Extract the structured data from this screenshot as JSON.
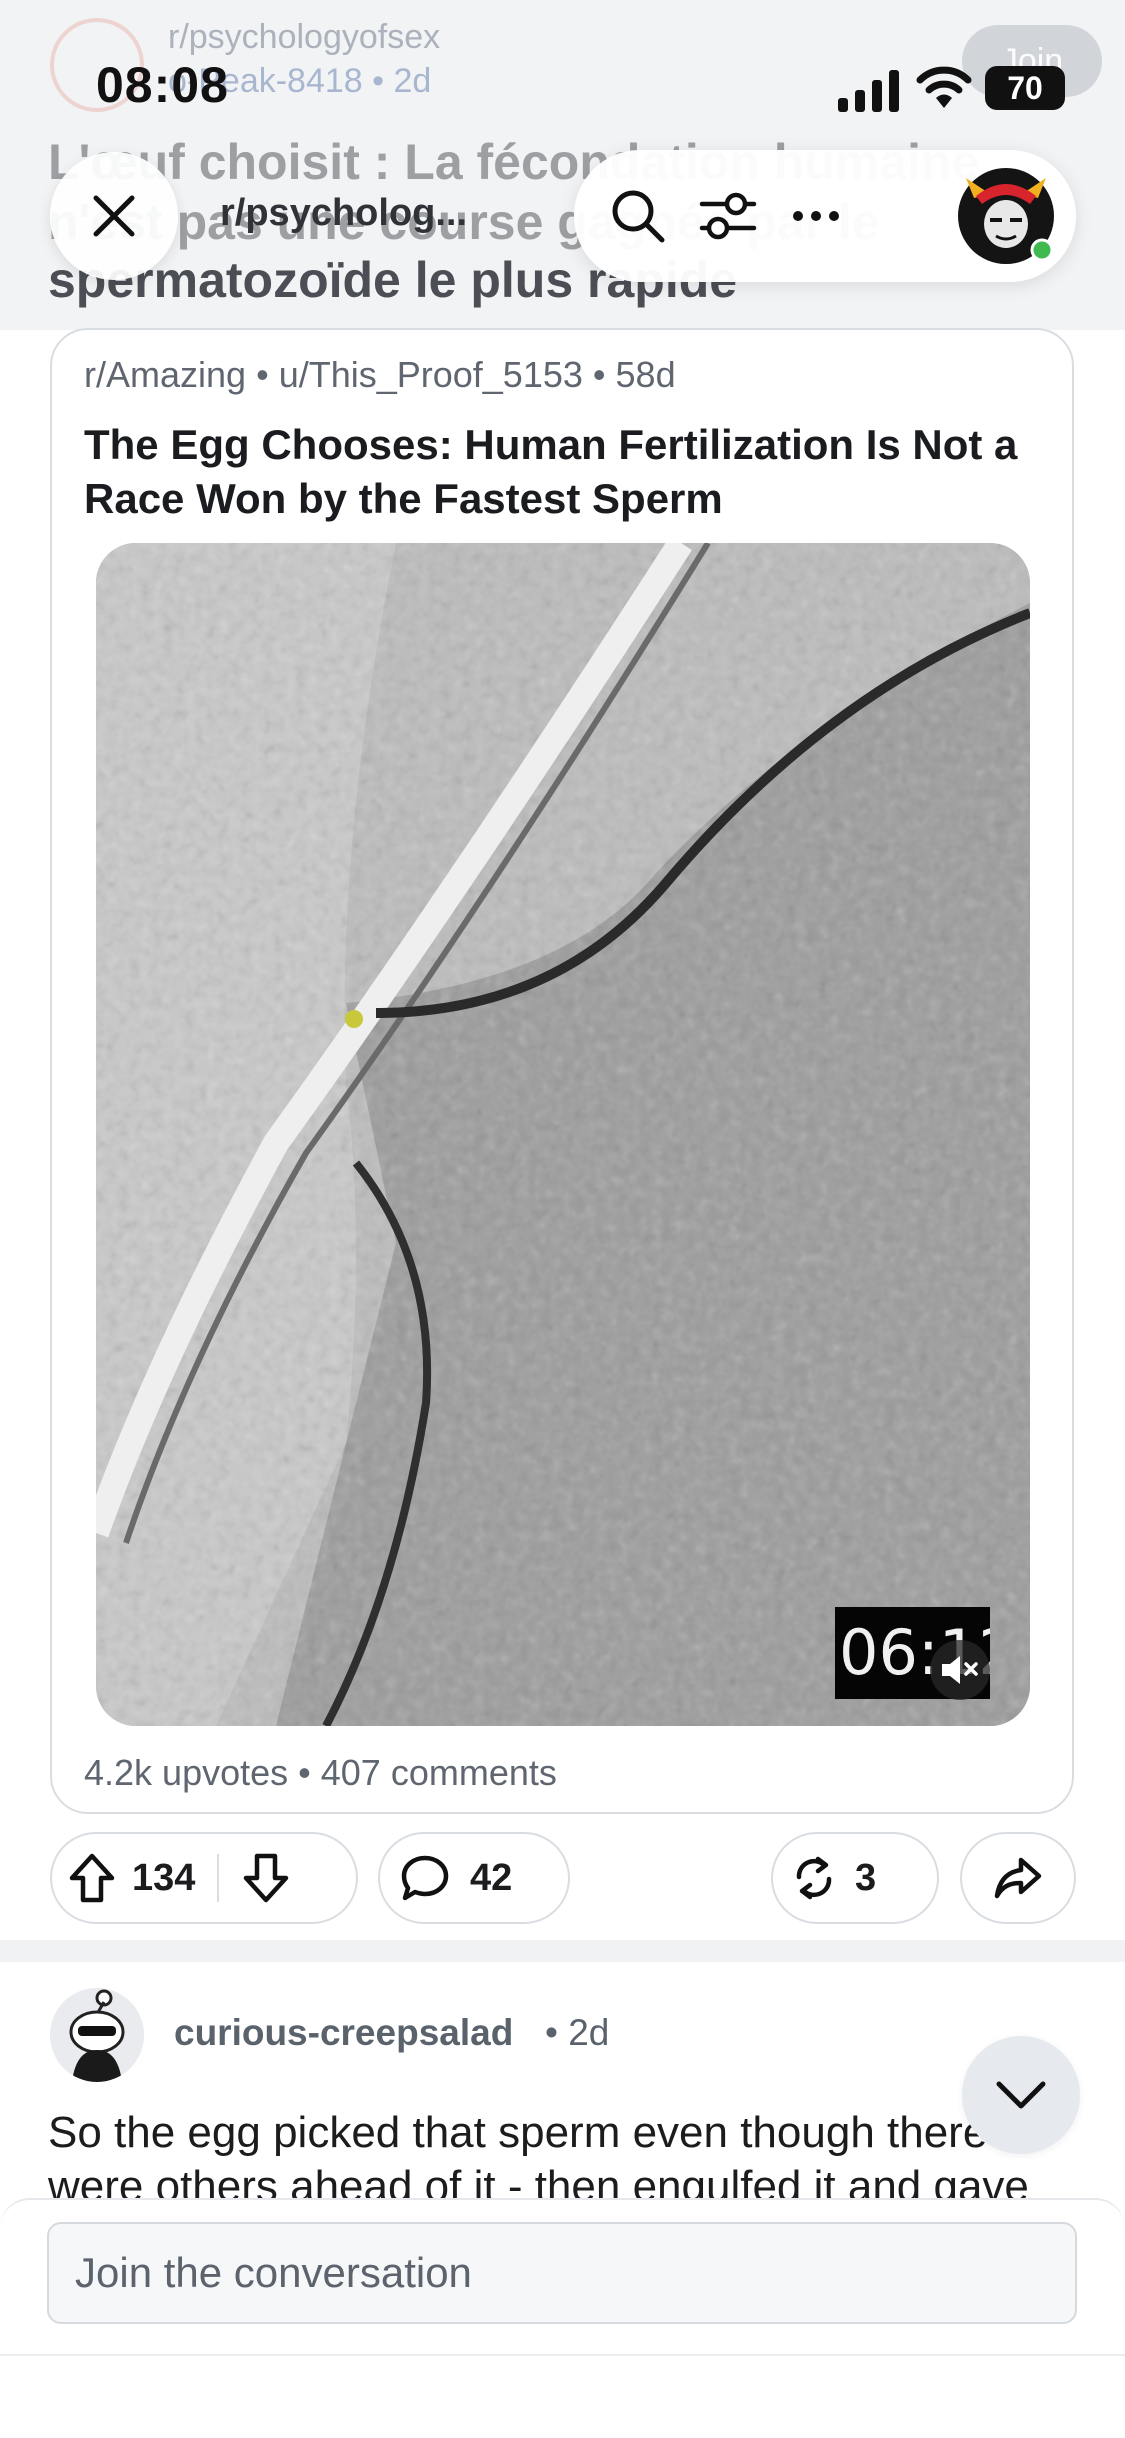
{
  "status_bar": {
    "time": "08:08",
    "battery": "70"
  },
  "background_post": {
    "subreddit": "r/psychologyofsex",
    "user_meta": "o-Peak-8418 • 2d",
    "join_label": "Join",
    "title_line1": "L'œuf choisit : La fécondation humaine",
    "title_line2": "n'est pas une course gagnée par le",
    "title_line3": "spermatozoïde le plus rapide"
  },
  "nav": {
    "title": "r/psycholog..."
  },
  "embedded_post": {
    "subreddit": "r/Amazing",
    "author": "u/This_Proof_5153",
    "age": "58d",
    "title": "The Egg Chooses: Human Fertilization Is Not a Race Won by the Fastest Sperm",
    "video_timestamp": "06:12",
    "upvotes": "4.2k upvotes",
    "comments": "407 comments"
  },
  "actions": {
    "score": "134",
    "comments": "42",
    "crossposts": "3"
  },
  "comment": {
    "username": "curious-creepsalad",
    "age": "2d",
    "text": "So the egg picked that sperm even though there were others ahead of it - then engulfed it and gave"
  },
  "reply": {
    "placeholder": "Join the conversation"
  },
  "colors": {
    "accent_green": "#3fb950",
    "text_secondary": "#5f6670",
    "border": "#d9dde2"
  }
}
